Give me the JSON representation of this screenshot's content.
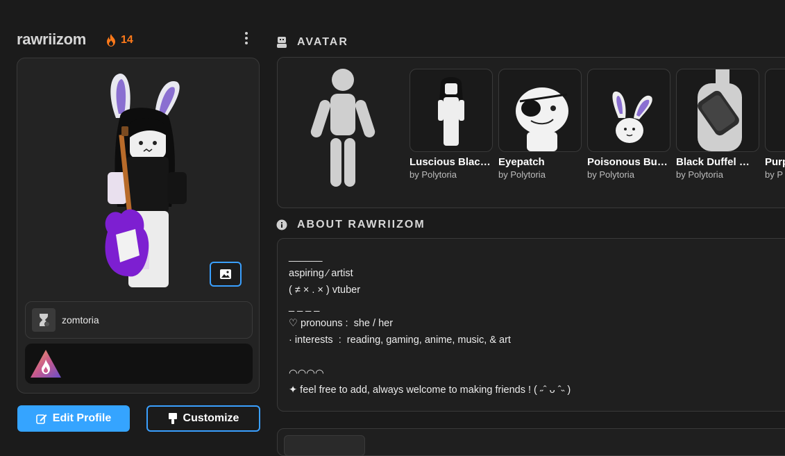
{
  "profile": {
    "username": "rawriizom",
    "streak_count": "14",
    "streak_color": "#ff7a1a"
  },
  "icons": {
    "streak": "flame-icon",
    "menu": "kebab-menu-icon",
    "image": "image-icon",
    "guild": "hourglass-icon",
    "badge": "flame-triangle-badge-icon",
    "edit": "pencil-icon",
    "customize": "paint-brush-icon",
    "avatar_section": "avatar-icon",
    "about_section": "info-icon"
  },
  "guild": {
    "name": "zomtoria"
  },
  "buttons": {
    "edit_profile": "Edit Profile",
    "customize": "Customize",
    "accent": "#35a4ff"
  },
  "sections": {
    "avatar_title": "AVATAR",
    "about_title": "ABOUT RAWRIIZOM"
  },
  "avatar_items": [
    {
      "name": "Luscious Blac…",
      "creator": "by Polytoria"
    },
    {
      "name": "Eyepatch",
      "creator": "by Polytoria"
    },
    {
      "name": "Poisonous Bu…",
      "creator": "by Polytoria"
    },
    {
      "name": "Black Duffel …",
      "creator": "by Polytoria"
    },
    {
      "name": "Purp",
      "creator": "by P"
    }
  ],
  "about": {
    "lines": [
      "______",
      "aspiring ⁄ artist",
      "( ≠ × . × ) vtuber",
      "_ _ _ _",
      "♡ pronouns :  she / her",
      "· interests  :  reading, gaming, anime, music, & art",
      "",
      "◠◠◠◠",
      "✦ feel free to add, always welcome to making friends ! ( ˶ˆ ᴗ ˆ˵ )"
    ]
  }
}
